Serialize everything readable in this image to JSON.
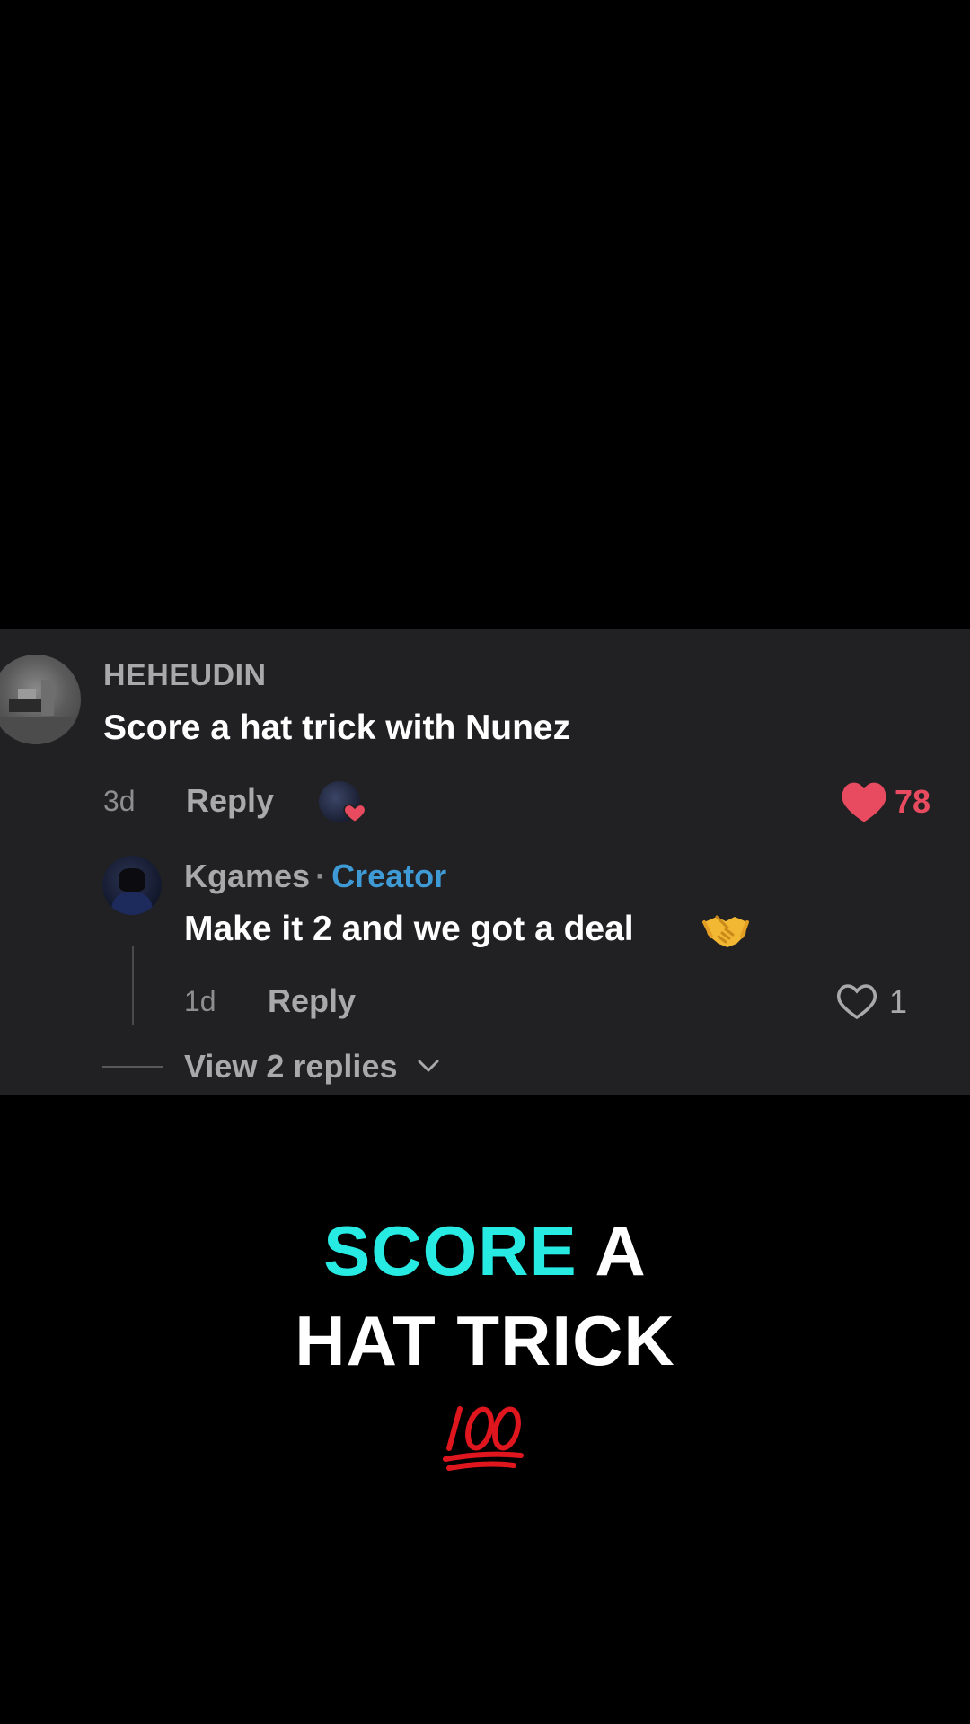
{
  "comment": {
    "username": "HEHEUDIN",
    "text": "Score a hat trick with Nunez",
    "age": "3d",
    "reply_label": "Reply",
    "like_count": "78",
    "liked_by_creator_icon": "creator-heart-icon",
    "accent_like_color": "#e84a5f"
  },
  "reply": {
    "username": "Kgames",
    "separator": "·",
    "badge": "Creator",
    "text": "Make it 2 and we got a deal",
    "emoji_icon": "handshake-icon",
    "age": "1d",
    "reply_label": "Reply",
    "like_count": "1",
    "badge_color": "#3e9bd6"
  },
  "thread": {
    "view_replies_label": "View 2 replies"
  },
  "caption": {
    "line1_accent": "SCORE",
    "line1_rest": "A",
    "line2": "HAT TRICK",
    "emoji_icon": "hundred-points-icon",
    "accent_color": "#27eae3"
  }
}
